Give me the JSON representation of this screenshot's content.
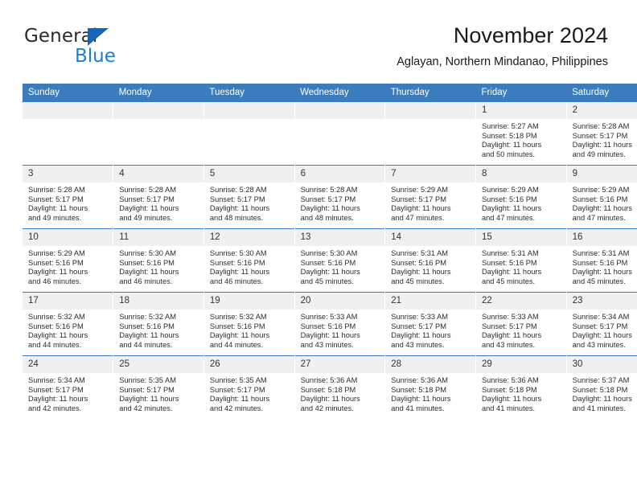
{
  "brand": {
    "name_top": "General",
    "name_bottom": "Blue",
    "color_blue": "#1b7fd4",
    "color_triangle": "#1565b8"
  },
  "header": {
    "title": "November 2024",
    "subtitle": "Aglayan, Northern Mindanao, Philippines"
  },
  "theme": {
    "header_row_bg": "#3a7cbe",
    "daynum_bg": "#f0f0f0",
    "text": "#2d2d2d"
  },
  "weekdays": [
    "Sunday",
    "Monday",
    "Tuesday",
    "Wednesday",
    "Thursday",
    "Friday",
    "Saturday"
  ],
  "weeks": [
    [
      {
        "empty": true
      },
      {
        "empty": true
      },
      {
        "empty": true
      },
      {
        "empty": true
      },
      {
        "empty": true
      },
      {
        "day": "1",
        "sunrise": "Sunrise: 5:27 AM",
        "sunset": "Sunset: 5:18 PM",
        "daylight_1": "Daylight: 11 hours",
        "daylight_2": "and 50 minutes."
      },
      {
        "day": "2",
        "sunrise": "Sunrise: 5:28 AM",
        "sunset": "Sunset: 5:17 PM",
        "daylight_1": "Daylight: 11 hours",
        "daylight_2": "and 49 minutes."
      }
    ],
    [
      {
        "day": "3",
        "sunrise": "Sunrise: 5:28 AM",
        "sunset": "Sunset: 5:17 PM",
        "daylight_1": "Daylight: 11 hours",
        "daylight_2": "and 49 minutes."
      },
      {
        "day": "4",
        "sunrise": "Sunrise: 5:28 AM",
        "sunset": "Sunset: 5:17 PM",
        "daylight_1": "Daylight: 11 hours",
        "daylight_2": "and 49 minutes."
      },
      {
        "day": "5",
        "sunrise": "Sunrise: 5:28 AM",
        "sunset": "Sunset: 5:17 PM",
        "daylight_1": "Daylight: 11 hours",
        "daylight_2": "and 48 minutes."
      },
      {
        "day": "6",
        "sunrise": "Sunrise: 5:28 AM",
        "sunset": "Sunset: 5:17 PM",
        "daylight_1": "Daylight: 11 hours",
        "daylight_2": "and 48 minutes."
      },
      {
        "day": "7",
        "sunrise": "Sunrise: 5:29 AM",
        "sunset": "Sunset: 5:17 PM",
        "daylight_1": "Daylight: 11 hours",
        "daylight_2": "and 47 minutes."
      },
      {
        "day": "8",
        "sunrise": "Sunrise: 5:29 AM",
        "sunset": "Sunset: 5:16 PM",
        "daylight_1": "Daylight: 11 hours",
        "daylight_2": "and 47 minutes."
      },
      {
        "day": "9",
        "sunrise": "Sunrise: 5:29 AM",
        "sunset": "Sunset: 5:16 PM",
        "daylight_1": "Daylight: 11 hours",
        "daylight_2": "and 47 minutes."
      }
    ],
    [
      {
        "day": "10",
        "sunrise": "Sunrise: 5:29 AM",
        "sunset": "Sunset: 5:16 PM",
        "daylight_1": "Daylight: 11 hours",
        "daylight_2": "and 46 minutes."
      },
      {
        "day": "11",
        "sunrise": "Sunrise: 5:30 AM",
        "sunset": "Sunset: 5:16 PM",
        "daylight_1": "Daylight: 11 hours",
        "daylight_2": "and 46 minutes."
      },
      {
        "day": "12",
        "sunrise": "Sunrise: 5:30 AM",
        "sunset": "Sunset: 5:16 PM",
        "daylight_1": "Daylight: 11 hours",
        "daylight_2": "and 46 minutes."
      },
      {
        "day": "13",
        "sunrise": "Sunrise: 5:30 AM",
        "sunset": "Sunset: 5:16 PM",
        "daylight_1": "Daylight: 11 hours",
        "daylight_2": "and 45 minutes."
      },
      {
        "day": "14",
        "sunrise": "Sunrise: 5:31 AM",
        "sunset": "Sunset: 5:16 PM",
        "daylight_1": "Daylight: 11 hours",
        "daylight_2": "and 45 minutes."
      },
      {
        "day": "15",
        "sunrise": "Sunrise: 5:31 AM",
        "sunset": "Sunset: 5:16 PM",
        "daylight_1": "Daylight: 11 hours",
        "daylight_2": "and 45 minutes."
      },
      {
        "day": "16",
        "sunrise": "Sunrise: 5:31 AM",
        "sunset": "Sunset: 5:16 PM",
        "daylight_1": "Daylight: 11 hours",
        "daylight_2": "and 45 minutes."
      }
    ],
    [
      {
        "day": "17",
        "sunrise": "Sunrise: 5:32 AM",
        "sunset": "Sunset: 5:16 PM",
        "daylight_1": "Daylight: 11 hours",
        "daylight_2": "and 44 minutes."
      },
      {
        "day": "18",
        "sunrise": "Sunrise: 5:32 AM",
        "sunset": "Sunset: 5:16 PM",
        "daylight_1": "Daylight: 11 hours",
        "daylight_2": "and 44 minutes."
      },
      {
        "day": "19",
        "sunrise": "Sunrise: 5:32 AM",
        "sunset": "Sunset: 5:16 PM",
        "daylight_1": "Daylight: 11 hours",
        "daylight_2": "and 44 minutes."
      },
      {
        "day": "20",
        "sunrise": "Sunrise: 5:33 AM",
        "sunset": "Sunset: 5:16 PM",
        "daylight_1": "Daylight: 11 hours",
        "daylight_2": "and 43 minutes."
      },
      {
        "day": "21",
        "sunrise": "Sunrise: 5:33 AM",
        "sunset": "Sunset: 5:17 PM",
        "daylight_1": "Daylight: 11 hours",
        "daylight_2": "and 43 minutes."
      },
      {
        "day": "22",
        "sunrise": "Sunrise: 5:33 AM",
        "sunset": "Sunset: 5:17 PM",
        "daylight_1": "Daylight: 11 hours",
        "daylight_2": "and 43 minutes."
      },
      {
        "day": "23",
        "sunrise": "Sunrise: 5:34 AM",
        "sunset": "Sunset: 5:17 PM",
        "daylight_1": "Daylight: 11 hours",
        "daylight_2": "and 43 minutes."
      }
    ],
    [
      {
        "day": "24",
        "sunrise": "Sunrise: 5:34 AM",
        "sunset": "Sunset: 5:17 PM",
        "daylight_1": "Daylight: 11 hours",
        "daylight_2": "and 42 minutes."
      },
      {
        "day": "25",
        "sunrise": "Sunrise: 5:35 AM",
        "sunset": "Sunset: 5:17 PM",
        "daylight_1": "Daylight: 11 hours",
        "daylight_2": "and 42 minutes."
      },
      {
        "day": "26",
        "sunrise": "Sunrise: 5:35 AM",
        "sunset": "Sunset: 5:17 PM",
        "daylight_1": "Daylight: 11 hours",
        "daylight_2": "and 42 minutes."
      },
      {
        "day": "27",
        "sunrise": "Sunrise: 5:36 AM",
        "sunset": "Sunset: 5:18 PM",
        "daylight_1": "Daylight: 11 hours",
        "daylight_2": "and 42 minutes."
      },
      {
        "day": "28",
        "sunrise": "Sunrise: 5:36 AM",
        "sunset": "Sunset: 5:18 PM",
        "daylight_1": "Daylight: 11 hours",
        "daylight_2": "and 41 minutes."
      },
      {
        "day": "29",
        "sunrise": "Sunrise: 5:36 AM",
        "sunset": "Sunset: 5:18 PM",
        "daylight_1": "Daylight: 11 hours",
        "daylight_2": "and 41 minutes."
      },
      {
        "day": "30",
        "sunrise": "Sunrise: 5:37 AM",
        "sunset": "Sunset: 5:18 PM",
        "daylight_1": "Daylight: 11 hours",
        "daylight_2": "and 41 minutes."
      }
    ]
  ]
}
